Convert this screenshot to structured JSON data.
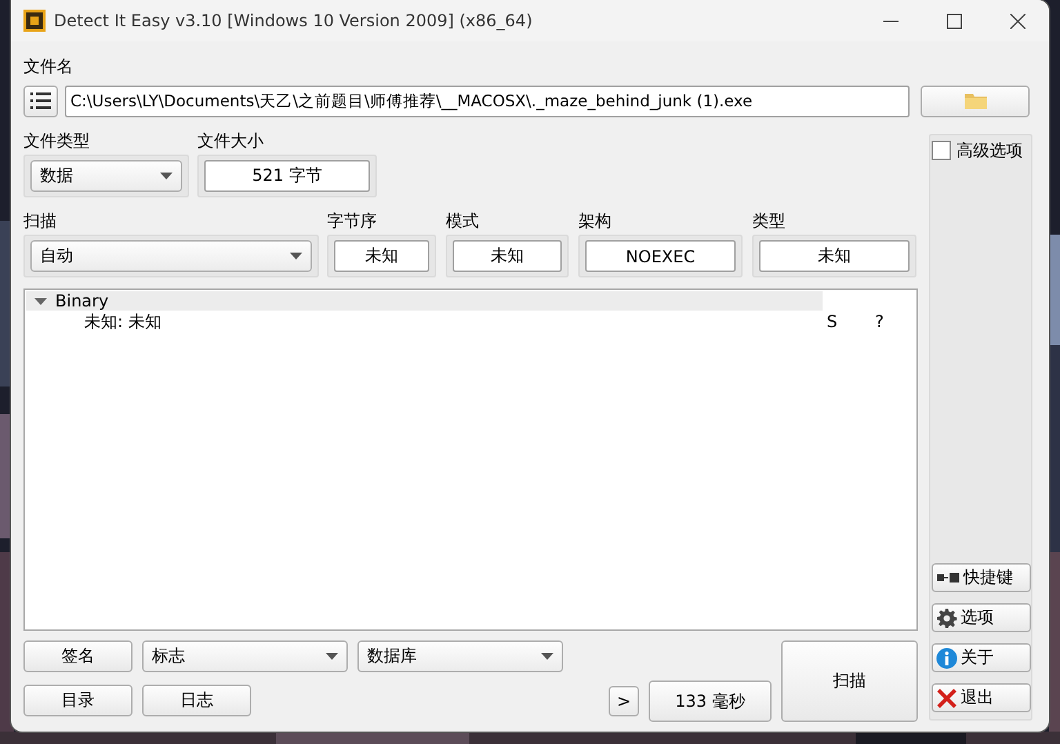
{
  "window": {
    "title": "Detect It Easy v3.10 [Windows 10 Version 2009] (x86_64)"
  },
  "file_name": {
    "label": "文件名",
    "value": "C:\\Users\\LY\\Documents\\天乙\\之前题目\\师傅推荐\\__MACOSX\\._maze_behind_junk (1).exe"
  },
  "file_type": {
    "label": "文件类型",
    "value": "数据"
  },
  "file_size": {
    "label": "文件大小",
    "value": "521 字节"
  },
  "scan_mode": {
    "label": "扫描",
    "value": "自动"
  },
  "info_fields": [
    {
      "label": "字节序",
      "value": "未知"
    },
    {
      "label": "模式",
      "value": "未知"
    },
    {
      "label": "架构",
      "value": "NOEXEC"
    },
    {
      "label": "类型",
      "value": "未知"
    }
  ],
  "advanced_options": {
    "label": "高级选项",
    "checked": false
  },
  "tree": [
    {
      "label": "Binary",
      "expanded": true,
      "children": [
        {
          "label": "未知: 未知",
          "column_2": "S",
          "column_3": "?"
        }
      ]
    }
  ],
  "bottom": {
    "signatures": "签名",
    "flags": "标志",
    "database": "数据库",
    "directory": "目录",
    "log": "日志",
    "more": ">",
    "elapsed": "133 毫秒",
    "scan": "扫描"
  },
  "side_buttons": [
    {
      "kind": "shortcuts",
      "label": "快捷键"
    },
    {
      "kind": "options",
      "label": "选项"
    },
    {
      "kind": "about",
      "label": "关于"
    },
    {
      "kind": "exit",
      "label": "退出"
    }
  ]
}
